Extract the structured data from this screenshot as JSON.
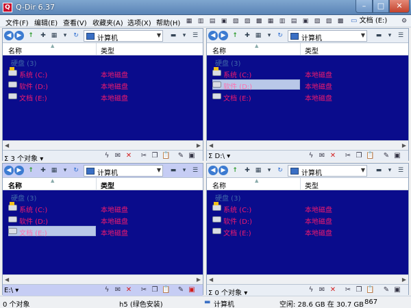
{
  "window": {
    "title": "Q-Dir 6.37",
    "min": "–",
    "max": "□",
    "close": "✕"
  },
  "menu": [
    {
      "label": "文件(F)"
    },
    {
      "label": "编辑(E)"
    },
    {
      "label": "查看(V)"
    },
    {
      "label": "收藏夹(A)"
    },
    {
      "label": "选项(X)"
    },
    {
      "label": "帮助(H)"
    }
  ],
  "toolbar": {
    "drive_label": "文档 (E:)"
  },
  "panes": [
    {
      "address": "计算机",
      "col_name": "名称",
      "col_type": "类型",
      "group": "硬盘 (3)",
      "rows": [
        {
          "name": "系统 (C:)",
          "type": "本地磁盘"
        },
        {
          "name": "软件 (D:)",
          "type": "本地磁盘"
        },
        {
          "name": "文档 (E:)",
          "type": "本地磁盘"
        }
      ],
      "status": "3 个对象"
    },
    {
      "address": "计算机",
      "col_name": "名称",
      "col_type": "类型",
      "group": "硬盘 (3)",
      "rows": [
        {
          "name": "系统 (C:)",
          "type": "本地磁盘"
        },
        {
          "name": "软件 (D:)",
          "type": "本地磁盘"
        },
        {
          "name": "文档 (E:)",
          "type": "本地磁盘"
        }
      ],
      "status": "D:\\"
    },
    {
      "address": "计算机",
      "col_name": "名称",
      "col_type": "类型",
      "group": "硬盘 (3)",
      "rows": [
        {
          "name": "系统 (C:)",
          "type": "本地磁盘"
        },
        {
          "name": "软件 (D:)",
          "type": "本地磁盘"
        },
        {
          "name": "文档 (E:)",
          "type": "本地磁盘"
        }
      ],
      "status": "E:\\"
    },
    {
      "address": "计算机",
      "col_name": "名称",
      "col_type": "类型",
      "group": "硬盘 (3)",
      "rows": [
        {
          "name": "系统 (C:)",
          "type": "本地磁盘"
        },
        {
          "name": "软件 (D:)",
          "type": "本地磁盘"
        },
        {
          "name": "文档 (E:)",
          "type": "本地磁盘"
        }
      ],
      "status": "0 个对象"
    }
  ],
  "bottom": {
    "objects": "0 个对象",
    "version": "h5 (绿色安装)",
    "location": "计算机",
    "space": "空闲: 28.6 GB 在 30.7 GB",
    "count": "867"
  },
  "colors": {
    "pane_bg": "#0a0c8c",
    "text_pink": "#f01a6e",
    "active_toolbar": "#c6cdf4"
  }
}
